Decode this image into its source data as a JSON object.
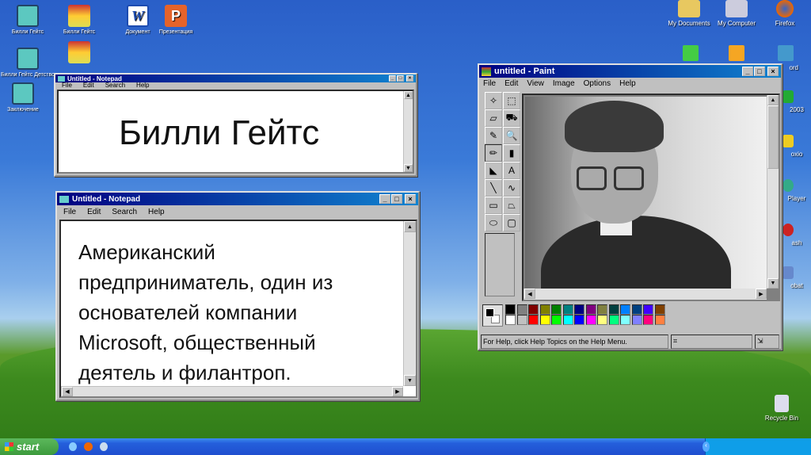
{
  "desktop_left": [
    {
      "label": "Билли Гейтс",
      "icon": "notepad-icon"
    },
    {
      "label": "Билли Гейтс",
      "icon": "paint-icon"
    },
    {
      "label": "Документ",
      "icon": "word-icon"
    },
    {
      "label": "Презентация",
      "icon": "powerpoint-icon"
    },
    {
      "label": "Билли Гейтс Детство",
      "icon": "notepad-icon"
    },
    {
      "label": "Заключение",
      "icon": "notepad-icon"
    }
  ],
  "desktop_right": [
    {
      "label": "My Documents"
    },
    {
      "label": "My Computer"
    },
    {
      "label": "Firefox"
    },
    {
      "label": "ord"
    },
    {
      "label": "2003"
    },
    {
      "label": "oxio"
    },
    {
      "label": "Player"
    },
    {
      "label": "ash"
    },
    {
      "label": "obat"
    },
    {
      "label": "Recycle Bin"
    }
  ],
  "notepad1": {
    "title": "Untitled - Notepad",
    "menu": [
      "File",
      "Edit",
      "Search",
      "Help"
    ],
    "text": "Билли Гейтс"
  },
  "notepad2": {
    "title": "Untitled - Notepad",
    "menu": [
      "File",
      "Edit",
      "Search",
      "Help"
    ],
    "lines": [
      "Американский",
      "предприниматель, один из",
      "основателей компании",
      "Microsoft, общественный",
      "деятель и филантроп."
    ]
  },
  "paint": {
    "title": "untitled - Paint",
    "menu": [
      "File",
      "Edit",
      "View",
      "Image",
      "Options",
      "Help"
    ],
    "status": "For Help, click Help Topics on the Help Menu.",
    "tools": [
      "✧",
      "⬚",
      "▱",
      "⛟",
      "✎",
      "🔍",
      "✏",
      "▮",
      "◣",
      "A",
      "╲",
      "∿",
      "▭",
      "⏢",
      "⬭",
      "▢"
    ],
    "palette_top": [
      "#000000",
      "#808080",
      "#800000",
      "#808000",
      "#008000",
      "#008080",
      "#000080",
      "#800080",
      "#808040",
      "#004040",
      "#0080ff",
      "#004080",
      "#4000ff",
      "#804000"
    ],
    "palette_bottom": [
      "#ffffff",
      "#c0c0c0",
      "#ff0000",
      "#ffff00",
      "#00ff00",
      "#00ffff",
      "#0000ff",
      "#ff00ff",
      "#ffff80",
      "#00ff80",
      "#80ffff",
      "#8080ff",
      "#ff0080",
      "#ff8040"
    ]
  },
  "taskbar": {
    "start": "start"
  }
}
